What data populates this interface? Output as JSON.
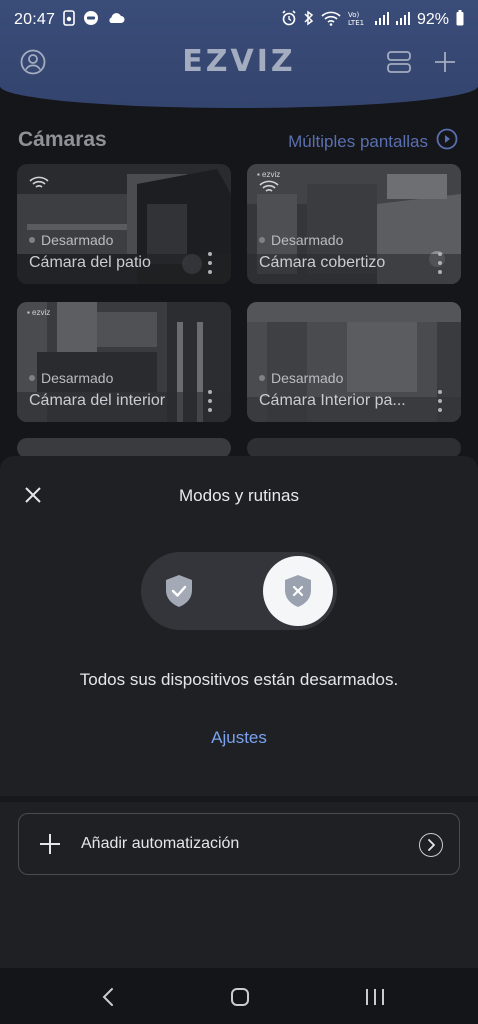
{
  "status_bar": {
    "time": "20:47",
    "battery": "92%",
    "icons": [
      "photo-icon",
      "app-badge-icon",
      "cloud-icon",
      "alarm-icon",
      "bluetooth-icon",
      "wifi-icon",
      "volte-icon",
      "signal-icon",
      "signal-icon",
      "battery-icon"
    ]
  },
  "header": {
    "logo": "EZVIZ",
    "icons": [
      "profile-icon",
      "devices-icon",
      "add-icon"
    ]
  },
  "cameras_section": {
    "title": "Cámaras",
    "multi_screen_label": "Múltiples pantallas",
    "cameras": [
      {
        "status": "Desarmado",
        "name": "Cámara del patio"
      },
      {
        "status": "Desarmado",
        "name": "Cámara cobertizo"
      },
      {
        "status": "Desarmado",
        "name": "Cámara del interior"
      },
      {
        "status": "Desarmado",
        "name": "Cámara Interior pa..."
      }
    ]
  },
  "sheet": {
    "title": "Modos y rutinas",
    "toggle": {
      "options": [
        "armed",
        "disarmed"
      ],
      "selected": "disarmed"
    },
    "message": "Todos sus dispositivos están desarmados.",
    "settings_link": "Ajustes",
    "add_automation_label": "Añadir automatización"
  },
  "colors": {
    "header_bg": "#3a4c78",
    "sheet_bg": "#1f2023",
    "link_blue": "#7aa2ee",
    "toggle_track": "#33353a",
    "shield_gray": "#a3aab6"
  },
  "nav_bar": {
    "icons": [
      "back-icon",
      "home-icon",
      "recents-icon"
    ]
  }
}
